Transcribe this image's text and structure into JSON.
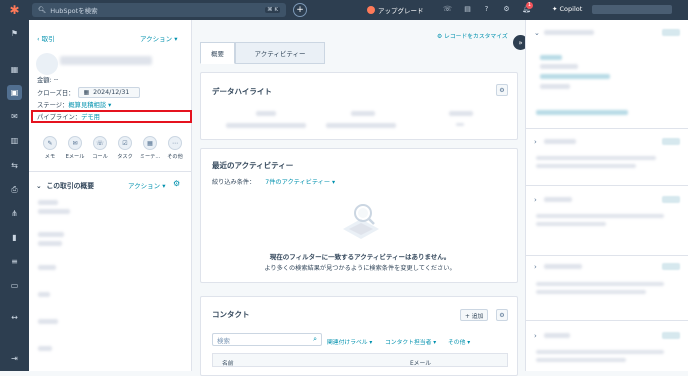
{
  "topbar": {
    "search_placeholder": "HubSpotを検索",
    "search_shortcut": "⌘ K",
    "upgrade_label": "アップグレード",
    "copilot_label": "Copilot",
    "notification_count": "1"
  },
  "left_panel": {
    "back_label": "取引",
    "actions_label": "アクション",
    "amount_label": "金額:",
    "amount_value": "--",
    "close_date_label": "クローズ日：",
    "close_date_value": "2024/12/31",
    "stage_label": "ステージ：",
    "stage_value": "概算見積相談",
    "pipeline_label": "パイプライン：",
    "pipeline_value": "デモ用",
    "activity_buttons": [
      "メモ",
      "Eメール",
      "コール",
      "タスク",
      "ミーテ...",
      "その他"
    ],
    "summary_title": "この取引の概要",
    "summary_actions_label": "アクション"
  },
  "center": {
    "tabs": [
      "概要",
      "アクティビティー"
    ],
    "customize_label": "レコードをカスタマイズ",
    "highlights_title": "データハイライト",
    "recent_activity_title": "最近のアクティビティー",
    "filter_label": "絞り込み条件：",
    "filter_value": "7件のアクティビティー",
    "empty_title": "現在のフィルターに一致するアクティビティーはありません。",
    "empty_sub": "より多くの検索結果が見つかるように検索条件を変更してください。",
    "contacts_title": "コンタクト",
    "add_label": "+ 追加",
    "contact_search_placeholder": "検索",
    "contact_filters": [
      "関連付けラベル",
      "コンタクト担当者",
      "その他"
    ],
    "table_headers": [
      "名前",
      "Eメール"
    ]
  },
  "colors": {
    "nav_bg": "#2d3e50",
    "link": "#0091ae",
    "highlight_border": "#e5131f",
    "logo": "#ff7a59"
  }
}
